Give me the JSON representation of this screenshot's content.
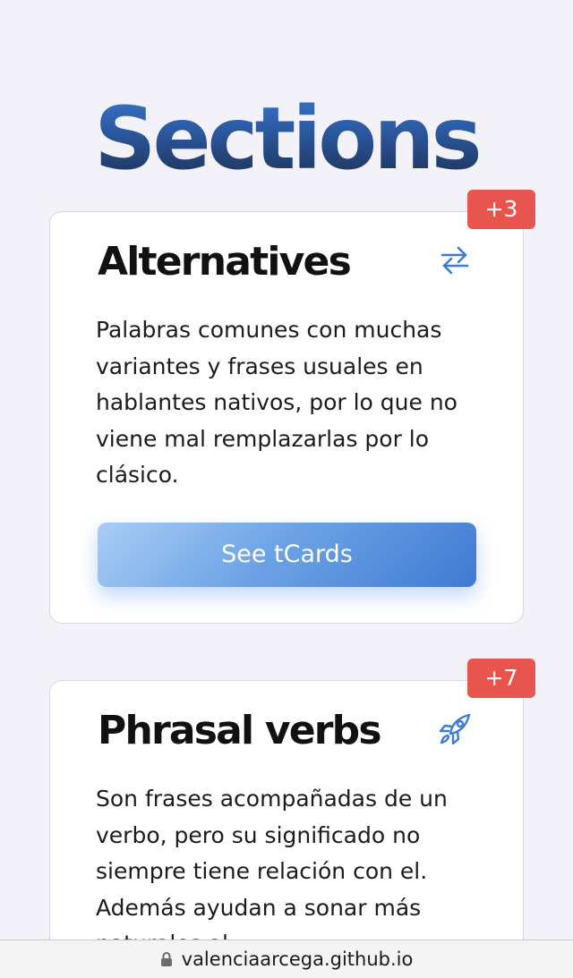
{
  "page": {
    "title": "Sections"
  },
  "sections": [
    {
      "title": "Alternatives",
      "badge": "+3",
      "icon": "swap-arrows-icon",
      "description": "Palabras comunes con muchas variantes y frases usuales en hablantes nativos, por lo que no viene mal remplazarlas por lo clásico.",
      "button_label": "See tCards"
    },
    {
      "title": "Phrasal verbs",
      "badge": "+7",
      "icon": "rocket-icon",
      "description": "Son frases acompañadas de un verbo, pero su significado no siempre tiene relación con el. Además ayudan a sonar más naturales al"
    }
  ],
  "browser": {
    "url": "valenciaarcega.github.io",
    "icon": "lock-icon"
  },
  "colors": {
    "accent": "#3f7ad3",
    "badge": "#e8554f",
    "background": "#f2f2f8"
  }
}
